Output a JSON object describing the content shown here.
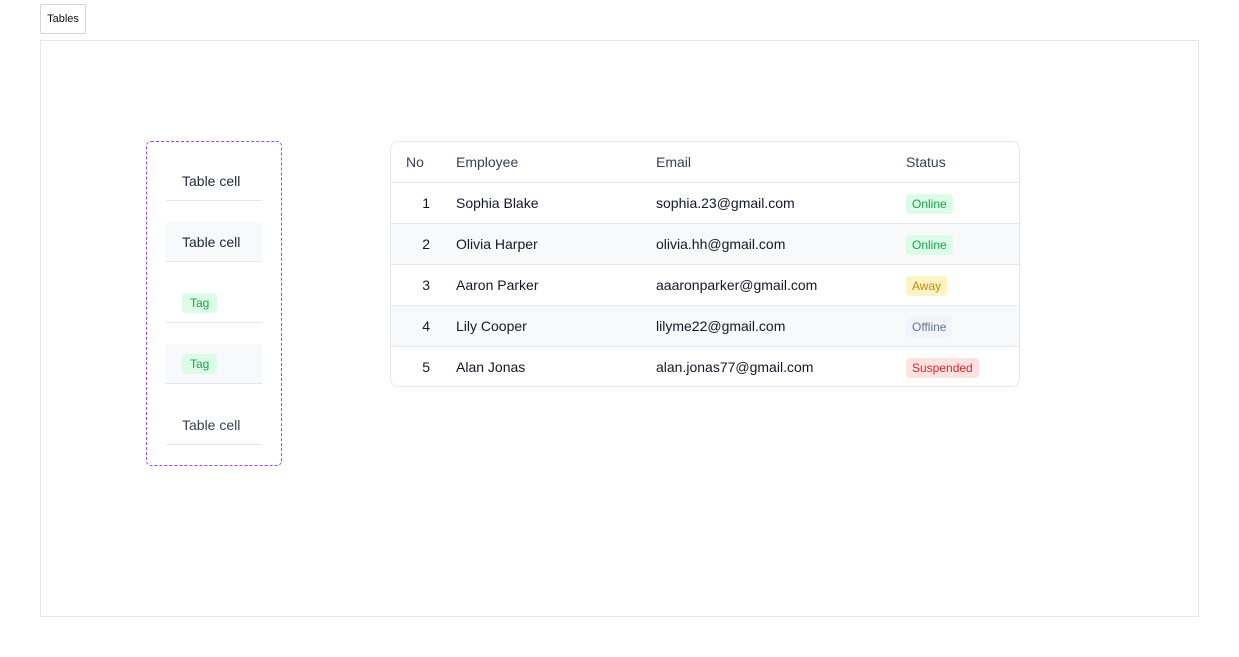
{
  "page": {
    "tab_label": "Tables"
  },
  "component_set": {
    "variants": [
      {
        "kind": "text",
        "text": "Table cell",
        "striped": false
      },
      {
        "kind": "text",
        "text": "Table cell",
        "striped": true
      },
      {
        "kind": "tag",
        "text": "Tag",
        "striped": false
      },
      {
        "kind": "tag",
        "text": "Tag",
        "striped": true
      },
      {
        "kind": "text",
        "text": "Table cell",
        "striped": false
      }
    ]
  },
  "table": {
    "columns": [
      "No",
      "Employee",
      "Email",
      "Status"
    ],
    "rows": [
      {
        "no": "1",
        "employee": "Sophia Blake",
        "email": "sophia.23@gmail.com",
        "status": "Online",
        "status_kind": "online"
      },
      {
        "no": "2",
        "employee": "Olivia Harper",
        "email": "olivia.hh@gmail.com",
        "status": "Online",
        "status_kind": "online"
      },
      {
        "no": "3",
        "employee": "Aaron Parker",
        "email": "aaaronparker@gmail.com",
        "status": "Away",
        "status_kind": "away"
      },
      {
        "no": "4",
        "employee": "Lily Cooper",
        "email": "lilyme22@gmail.com",
        "status": "Offline",
        "status_kind": "offline"
      },
      {
        "no": "5",
        "employee": "Alan Jonas",
        "email": "alan.jonas77@gmail.com",
        "status": "Suspended",
        "status_kind": "suspended"
      }
    ]
  },
  "colors": {
    "online": "#16a34a",
    "away": "#ca8a04",
    "offline": "#64748b",
    "suspended": "#dc2626",
    "component_border": "#9747ff"
  }
}
